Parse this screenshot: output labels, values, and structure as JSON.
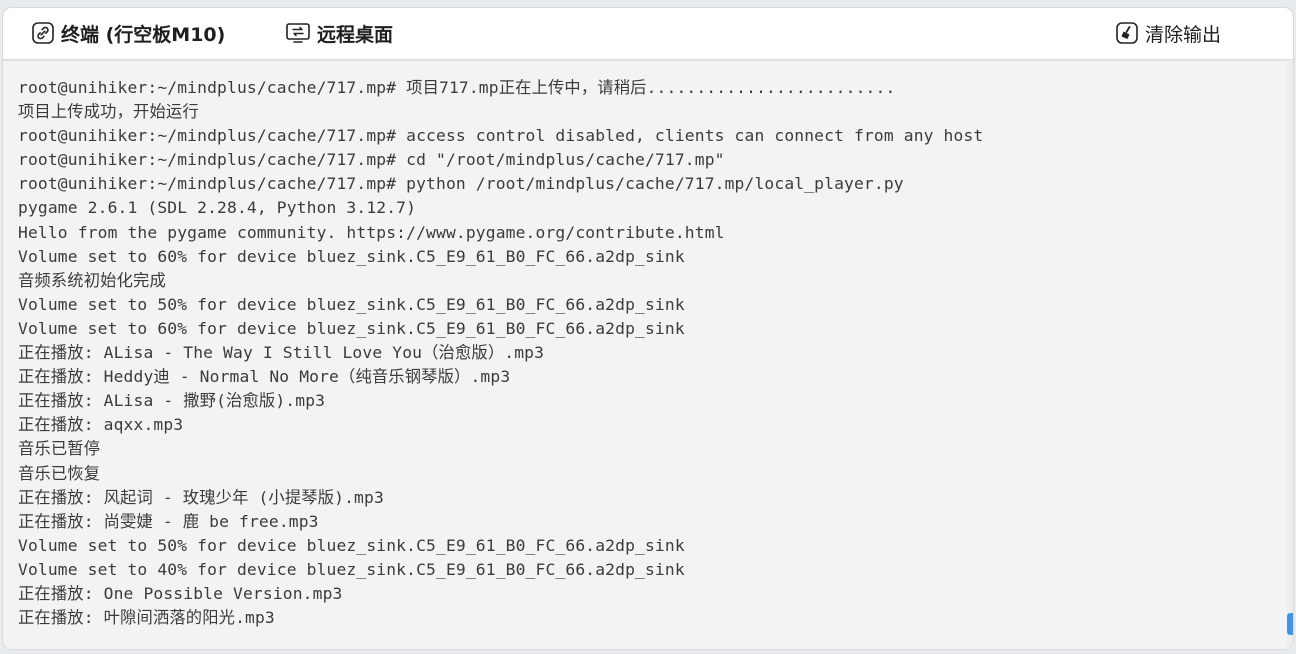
{
  "toolbar": {
    "terminal_label": "终端 (行空板M10)",
    "remote_label": "远程桌面",
    "clear_label": "清除输出"
  },
  "icons": {
    "terminal": "link-icon",
    "remote": "remote-desktop-icon",
    "clear": "broom-icon"
  },
  "colors": {
    "terminal_bg": "#f3f3f3",
    "terminal_text": "#3b3b3b",
    "scroll_thumb": "#4a90e2"
  },
  "terminal": {
    "lines": [
      "root@unihiker:~/mindplus/cache/717.mp# 项目717.mp正在上传中，请稍后.........................",
      "项目上传成功，开始运行",
      "root@unihiker:~/mindplus/cache/717.mp# access control disabled, clients can connect from any host",
      "root@unihiker:~/mindplus/cache/717.mp# cd \"/root/mindplus/cache/717.mp\"",
      "root@unihiker:~/mindplus/cache/717.mp# python /root/mindplus/cache/717.mp/local_player.py",
      "pygame 2.6.1 (SDL 2.28.4, Python 3.12.7)",
      "Hello from the pygame community. https://www.pygame.org/contribute.html",
      "Volume set to 60% for device bluez_sink.C5_E9_61_B0_FC_66.a2dp_sink",
      "音频系统初始化完成",
      "Volume set to 50% for device bluez_sink.C5_E9_61_B0_FC_66.a2dp_sink",
      "Volume set to 60% for device bluez_sink.C5_E9_61_B0_FC_66.a2dp_sink",
      "正在播放: ALisa - The Way I Still Love You（治愈版）.mp3",
      "正在播放: Heddy迪 - Normal No More（纯音乐钢琴版）.mp3",
      "正在播放: ALisa - 撒野(治愈版).mp3",
      "正在播放: aqxx.mp3",
      "音乐已暂停",
      "音乐已恢复",
      "正在播放: 风起词 - 玫瑰少年 (小提琴版).mp3",
      "正在播放: 尚雯婕 - 鹿 be free.mp3",
      "Volume set to 50% for device bluez_sink.C5_E9_61_B0_FC_66.a2dp_sink",
      "Volume set to 40% for device bluez_sink.C5_E9_61_B0_FC_66.a2dp_sink",
      "正在播放: One Possible Version.mp3",
      "正在播放: 叶隙间洒落的阳光.mp3"
    ]
  }
}
